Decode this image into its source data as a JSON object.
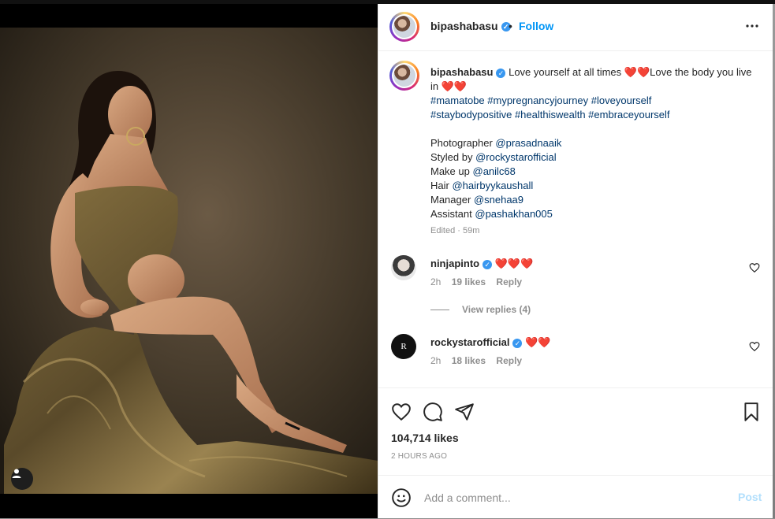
{
  "post": {
    "username": "bipashabasu",
    "follow_label": "Follow",
    "separator": "•",
    "caption": {
      "text": "Love yourself at all times ❤️❤️Love the body you live in ❤️❤️",
      "hashtags_line1": "#mamatobe #mypregnancyjourney #loveyourself",
      "hashtags_line2": "#staybodypositive #healthiswealth #embraceyourself",
      "credits": [
        {
          "label": "Photographer",
          "handle": "@prasadnaaik"
        },
        {
          "label": "Styled by",
          "handle": "@rockystarofficial"
        },
        {
          "label": "Make up",
          "handle": "@anilc68"
        },
        {
          "label": "Hair",
          "handle": "@hairbyykaushall"
        },
        {
          "label": "Manager",
          "handle": "@snehaa9"
        },
        {
          "label": "Assistant",
          "handle": "@pashakhan005"
        }
      ],
      "edited": "Edited · 59m"
    },
    "comments": [
      {
        "username": "ninjapinto",
        "text": "❤️❤️❤️",
        "time": "2h",
        "likes": "19 likes",
        "reply": "Reply"
      },
      {
        "username": "rockystarofficial",
        "text": "❤️❤️",
        "time": "2h",
        "likes": "18 likes",
        "reply": "Reply"
      }
    ],
    "view_replies": "View replies (4)",
    "likes_count": "104,714 likes",
    "posted_time": "2 HOURS AGO",
    "comment_placeholder": "Add a comment...",
    "post_label": "Post"
  },
  "icons": {
    "more": "more-options-icon",
    "like": "heart-icon",
    "comment": "comment-icon",
    "share": "share-icon",
    "save": "bookmark-icon",
    "emoji": "emoji-icon",
    "user_tag": "user-tag-icon",
    "verified": "verified-badge-icon"
  },
  "colors": {
    "accent": "#0095f6",
    "verified": "#3897f0",
    "hashtag": "#00376b",
    "muted": "#8e8e8e",
    "post_disabled": "#b2dffc"
  }
}
